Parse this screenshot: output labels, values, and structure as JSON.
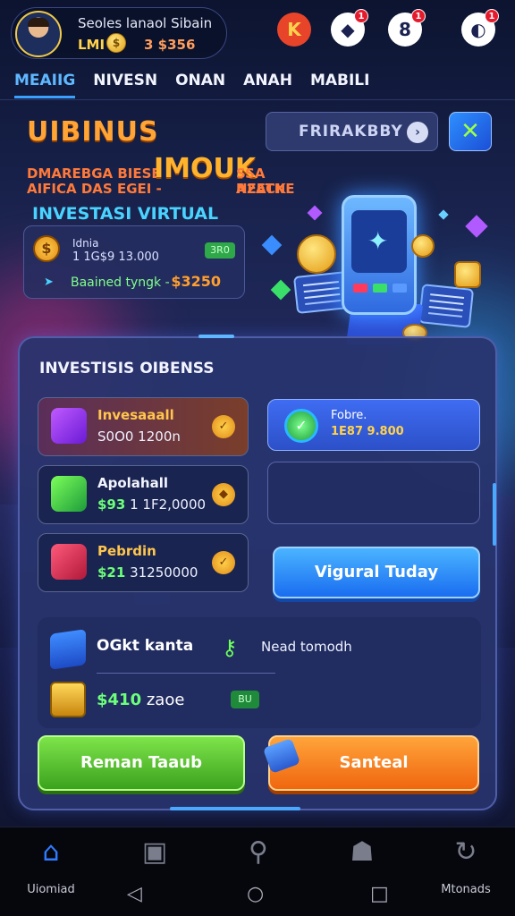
{
  "header": {
    "profile_name": "Seoles lanaol Sibain",
    "level": "LMI",
    "coin_symbol": "$",
    "balance": "3 $356",
    "icons": [
      {
        "name": "reward-icon",
        "glyph": "K",
        "badge": ""
      },
      {
        "name": "shield-notification-icon",
        "glyph": "◆",
        "badge": "1"
      },
      {
        "name": "target-notification-icon",
        "glyph": "8",
        "badge": "1"
      },
      {
        "name": "headset-notification-icon",
        "glyph": "◐",
        "badge": "1"
      }
    ]
  },
  "tabs": [
    "MEAIIG",
    "NIVESN",
    "ONAN",
    "ANAH",
    "MABILI"
  ],
  "hero": {
    "title": "UIBINUS",
    "filter_label": "FRIRAKBBY",
    "filter_arrow": "›",
    "close_glyph": "✕",
    "promo_line1": "DMAREBGA BIESE",
    "promo_line2": "AIFICA DAS EGEI -",
    "promo_big": "IMOUK",
    "promo_tail1": "SSA NEECK",
    "promo_tail2": "A2ATNE",
    "subtitle": "INVESTASI VIRTUAL",
    "stat1_label": "Idnia",
    "stat1_value": "1 1G$9 13.000",
    "stat1_pill": "3R0",
    "stat2_label": "Baained tyngk -",
    "stat2_value": "$3250"
  },
  "panel": {
    "title": "INVESTISIS OIBENSS",
    "cards": [
      {
        "name": "Invesaaall",
        "prefix": "",
        "value": "S0O0 1200n"
      },
      {
        "name": "Apolahall",
        "prefix": "$93",
        "value": "1 1F2,0000"
      },
      {
        "name": "Pebrdin",
        "prefix": "$21",
        "value": "31250000"
      }
    ],
    "check_card_line1": "Fobre.",
    "check_card_line2": "1E87 9.800",
    "virtual_button": "Vigural Tuday",
    "row1_label": "OGkt kanta",
    "row1_label2": "Nead tomodh",
    "amount_prefix": "$410",
    "amount_suffix": "zaoe",
    "tag": "BU",
    "green_button": "Reman Taaub",
    "orange_button": "Santeal"
  },
  "bottom_nav": [
    {
      "name": "home",
      "label": "Uiomiad",
      "glyph": "⌂"
    },
    {
      "name": "portfolio",
      "label": "",
      "glyph": "▣"
    },
    {
      "name": "search",
      "label": "",
      "glyph": "⚲"
    },
    {
      "name": "community",
      "label": "",
      "glyph": "☗"
    },
    {
      "name": "history",
      "label": "Mtonads",
      "glyph": "↻"
    }
  ],
  "system_nav": {
    "back": "◁",
    "home": "○",
    "recent": "□"
  },
  "colors": {
    "accent_blue": "#3aa0ff",
    "accent_orange": "#ffa435",
    "accent_green": "#6cff7a"
  }
}
